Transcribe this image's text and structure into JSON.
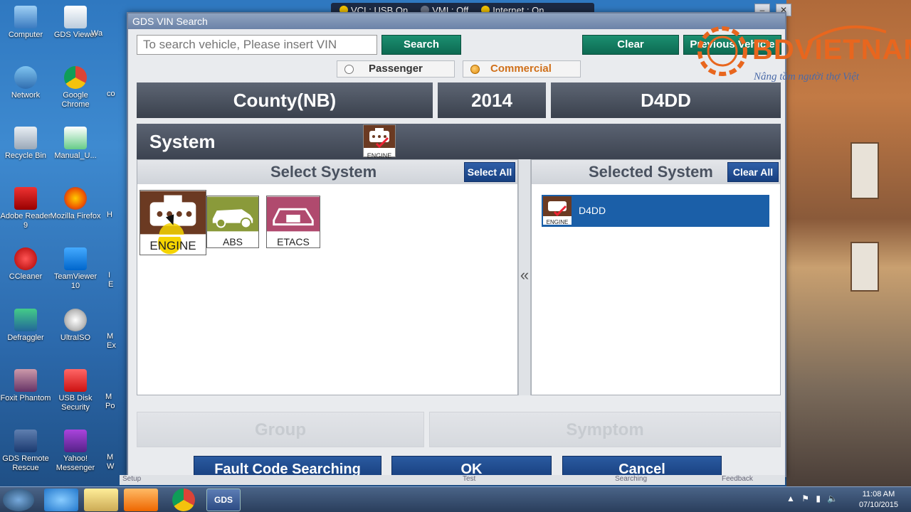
{
  "status_bar": {
    "vci": "VCI : USB On",
    "vmi": "VMI : Off",
    "internet": "Internet : On",
    "colors": {
      "on": "#f2c200",
      "off": "#6a7284"
    }
  },
  "dialog": {
    "title": "GDS VIN Search",
    "search": {
      "placeholder": "To search vehicle, Please insert VIN",
      "search_label": "Search",
      "clear_label": "Clear",
      "previous_label": "Previous Vehicle"
    },
    "vehicle_type": {
      "passenger_label": "Passenger",
      "commercial_label": "Commercial",
      "selected": "Commercial"
    },
    "vehicle": {
      "model": "County(NB)",
      "year": "2014",
      "engine": "D4DD"
    },
    "system_bar": {
      "title": "System",
      "icon_label": "ENGINE"
    },
    "select_panel": {
      "title": "Select System",
      "select_all_label": "Select All",
      "tiles": [
        {
          "label": "ENGINE",
          "icon": "engine-icon"
        },
        {
          "label": "ABS",
          "icon": "car-abs-icon"
        },
        {
          "label": "ETACS",
          "icon": "car-battery-icon"
        }
      ],
      "collapse_glyph": "«"
    },
    "selected_panel": {
      "title": "Selected System",
      "clear_all_label": "Clear All",
      "items": [
        {
          "label": "D4DD",
          "icon_label": "ENGINE"
        }
      ]
    },
    "group_label": "Group",
    "symptom_label": "Symptom",
    "fault_code_label": "Fault Code Searching",
    "ok_label": "OK",
    "cancel_label": "Cancel",
    "bottom_strip": {
      "setup": "Setup",
      "test": "Test",
      "searching": "Searching",
      "feedback": "Feedback"
    }
  },
  "desktop_icons": [
    {
      "label": "Computer"
    },
    {
      "label": "GDS Viewer"
    },
    {
      "label": "Wa"
    },
    {
      "label": "Network"
    },
    {
      "label": "Google Chrome"
    },
    {
      "label": "co"
    },
    {
      "label": "Recycle Bin"
    },
    {
      "label": "Manual_U..."
    },
    {
      "label": "Adobe Reader 9"
    },
    {
      "label": "Mozilla Firefox"
    },
    {
      "label": "H"
    },
    {
      "label": "CCleaner"
    },
    {
      "label": "TeamViewer 10"
    },
    {
      "label": "I E"
    },
    {
      "label": "Defraggler"
    },
    {
      "label": "UltraISO"
    },
    {
      "label": "M Ex"
    },
    {
      "label": "Foxit Phantom"
    },
    {
      "label": "USB Disk Security"
    },
    {
      "label": "M Po"
    },
    {
      "label": "GDS Remote Rescue"
    },
    {
      "label": "Yahoo! Messenger"
    },
    {
      "label": "M W"
    }
  ],
  "watermark": {
    "brand": "BDVIETNAM",
    "slogan": "Nâng tầm người thợ Việt",
    "color": "#e8661e"
  },
  "taskbar": {
    "gds_label": "GDS",
    "time": "11:08 AM",
    "date": "07/10/2015"
  }
}
